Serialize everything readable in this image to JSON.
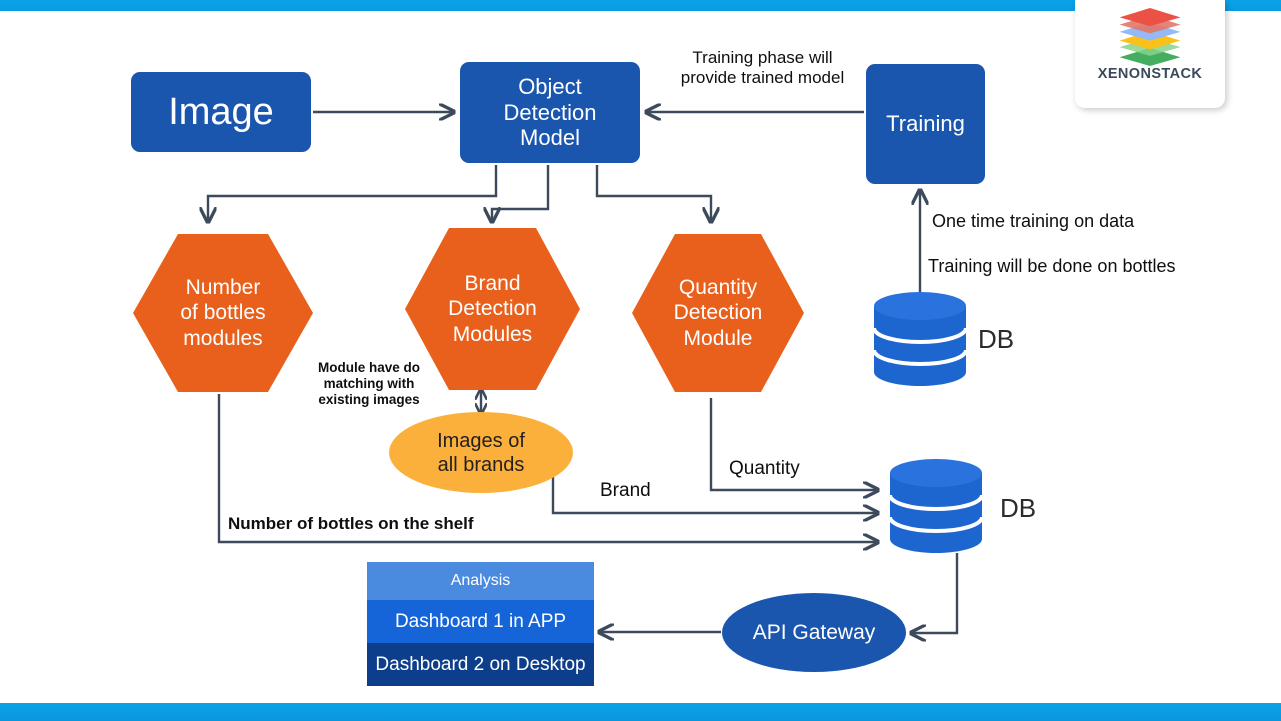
{
  "theme": {
    "accent_bar": "#0AA3E8",
    "blue_box": "#1A56AE",
    "orange_hex": "#E8601C",
    "amber_ellipse": "#FBB03B",
    "db_blue": "#1D66D0",
    "arrow": "#3D4A5C",
    "analysis_header": "#4A8BE0",
    "analysis_row1": "#1565D8",
    "analysis_row2": "#0D3E8C"
  },
  "brand": {
    "name": "XENONSTACK",
    "logo_icon": "stacked-layers-icon"
  },
  "nodes": {
    "image": "Image",
    "object_detection_model": "Object\nDetection\nModel",
    "training": "Training",
    "number_of_bottles": "Number\nof bottles\nmodules",
    "brand_detection": "Brand\nDetection\nModules",
    "quantity_detection": "Quantity\nDetection\nModule",
    "images_of_all_brands": "Images of\nall brands",
    "api_gateway": "API Gateway",
    "db_top": "DB",
    "db_bottom": "DB"
  },
  "labels": {
    "training_phase": "Training phase will\nprovide trained model",
    "one_time_training": "One time training on data",
    "training_on_bottles": "Training will be done on bottles",
    "module_matching": "Module have do\nmatching with\nexisting images",
    "quantity": "Quantity",
    "brand": "Brand",
    "number_on_shelf": "Number of bottles on the shelf"
  },
  "analysis": {
    "header": "Analysis",
    "rows": [
      "Dashboard 1 in APP",
      "Dashboard 2 on Desktop"
    ]
  },
  "chart_data": {
    "type": "diagram",
    "title": "Bottle detection pipeline architecture",
    "nodes": [
      {
        "id": "image",
        "label": "Image",
        "shape": "rounded-rect",
        "color": "#1A56AE"
      },
      {
        "id": "odm",
        "label": "Object Detection Model",
        "shape": "rounded-rect",
        "color": "#1A56AE"
      },
      {
        "id": "training",
        "label": "Training",
        "shape": "rounded-rect",
        "color": "#1A56AE"
      },
      {
        "id": "db_top",
        "label": "DB",
        "shape": "cylinder",
        "color": "#1D66D0"
      },
      {
        "id": "hex_number",
        "label": "Number of bottles modules",
        "shape": "hexagon",
        "color": "#E8601C"
      },
      {
        "id": "hex_brand",
        "label": "Brand Detection Modules",
        "shape": "hexagon",
        "color": "#E8601C"
      },
      {
        "id": "hex_quantity",
        "label": "Quantity Detection Module",
        "shape": "hexagon",
        "color": "#E8601C"
      },
      {
        "id": "images_brands",
        "label": "Images of all brands",
        "shape": "ellipse",
        "color": "#FBB03B"
      },
      {
        "id": "db_bottom",
        "label": "DB",
        "shape": "cylinder",
        "color": "#1D66D0"
      },
      {
        "id": "api_gateway",
        "label": "API Gateway",
        "shape": "ellipse",
        "color": "#1A56AE"
      },
      {
        "id": "analysis",
        "label": "Analysis",
        "shape": "table",
        "color": "#1565D8"
      }
    ],
    "edges": [
      {
        "from": "image",
        "to": "odm",
        "label": ""
      },
      {
        "from": "training",
        "to": "odm",
        "label": "Training phase will provide trained model"
      },
      {
        "from": "db_top",
        "to": "training",
        "label": "One time training on data / Training will be done on bottles"
      },
      {
        "from": "odm",
        "to": "hex_number",
        "label": ""
      },
      {
        "from": "odm",
        "to": "hex_brand",
        "label": ""
      },
      {
        "from": "odm",
        "to": "hex_quantity",
        "label": ""
      },
      {
        "from": "hex_brand",
        "to": "images_brands",
        "label": "Module have do matching with existing images",
        "bidirectional": true
      },
      {
        "from": "hex_quantity",
        "to": "db_bottom",
        "label": "Quantity"
      },
      {
        "from": "images_brands",
        "to": "db_bottom",
        "label": "Brand"
      },
      {
        "from": "hex_number",
        "to": "db_bottom",
        "label": "Number of bottles on the shelf"
      },
      {
        "from": "db_bottom",
        "to": "api_gateway",
        "label": ""
      },
      {
        "from": "api_gateway",
        "to": "analysis",
        "label": ""
      }
    ]
  }
}
